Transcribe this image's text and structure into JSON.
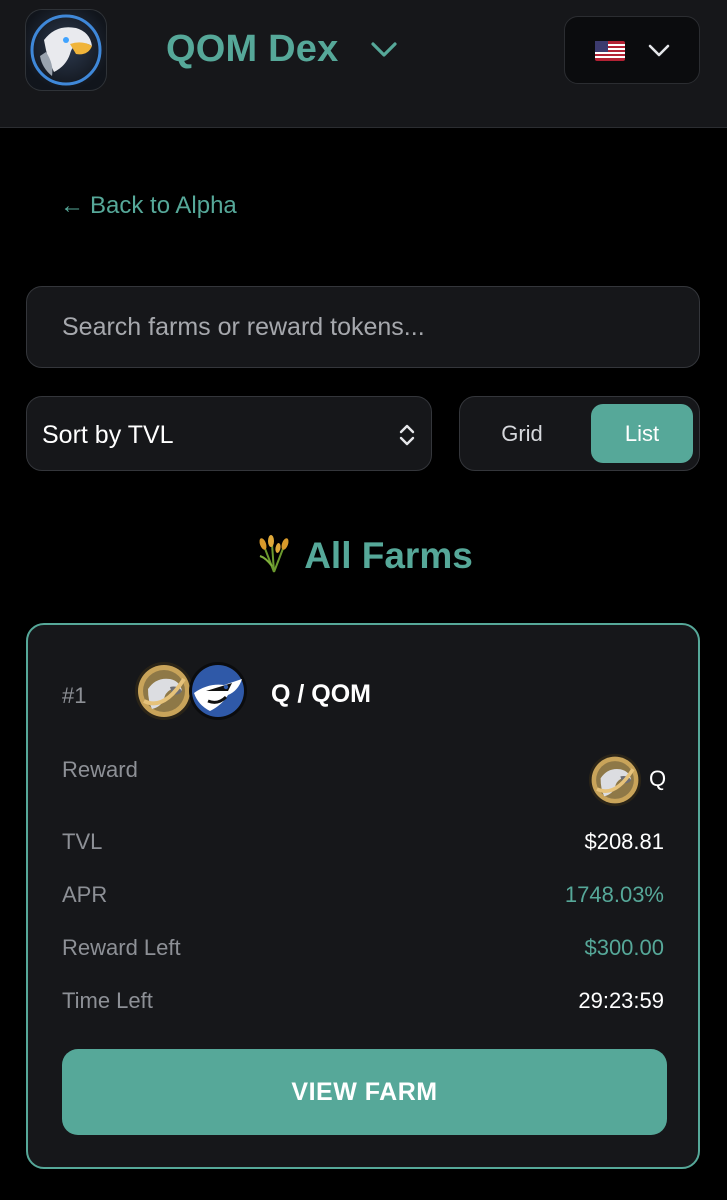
{
  "header": {
    "app_title": "QOM Dex",
    "language_flag": "us-flag-icon",
    "logo": "eagle-logo-icon"
  },
  "back_link": {
    "arrow": "←",
    "label": "Back to Alpha"
  },
  "search": {
    "placeholder": "Search farms or reward tokens...",
    "value": ""
  },
  "sort": {
    "selected": "Sort by TVL"
  },
  "view_toggle": {
    "options": [
      "Grid",
      "List"
    ],
    "active": "List"
  },
  "section": {
    "emoji": "🌾",
    "title": "All Farms"
  },
  "farms": [
    {
      "rank": "#1",
      "pair": "Q / QOM",
      "reward_label": "Reward",
      "reward_token": "Q",
      "tvl_label": "TVL",
      "tvl": "$208.81",
      "apr_label": "APR",
      "apr": "1748.03%",
      "reward_left_label": "Reward Left",
      "reward_left": "$300.00",
      "time_left_label": "Time Left",
      "time_left": "29:23:59",
      "button": "VIEW FARM"
    }
  ],
  "colors": {
    "accent": "#56a899",
    "background": "#000000",
    "surface": "#16171a",
    "muted_text": "#8d9096"
  }
}
